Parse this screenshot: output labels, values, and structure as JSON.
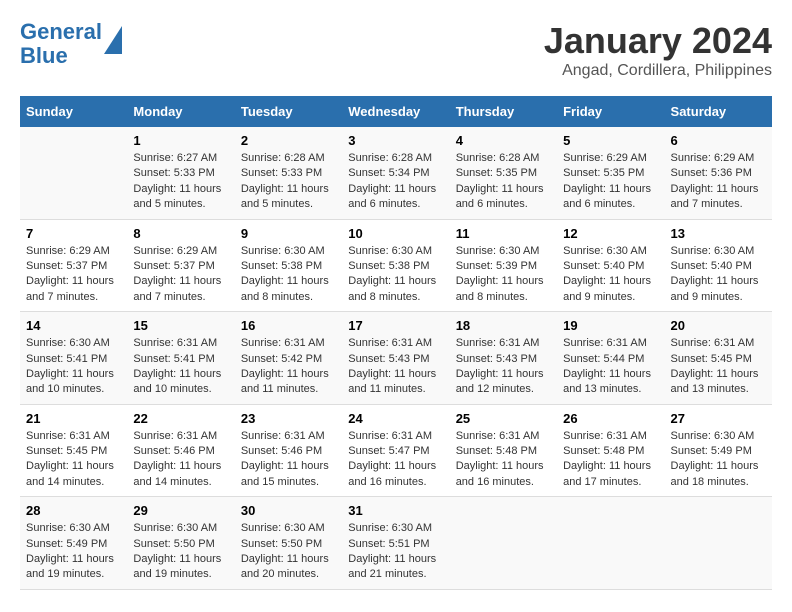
{
  "header": {
    "logo_line1": "General",
    "logo_line2": "Blue",
    "month": "January 2024",
    "location": "Angad, Cordillera, Philippines"
  },
  "weekdays": [
    "Sunday",
    "Monday",
    "Tuesday",
    "Wednesday",
    "Thursday",
    "Friday",
    "Saturday"
  ],
  "weeks": [
    [
      {
        "day": "",
        "sunrise": "",
        "sunset": "",
        "daylight": ""
      },
      {
        "day": "1",
        "sunrise": "Sunrise: 6:27 AM",
        "sunset": "Sunset: 5:33 PM",
        "daylight": "Daylight: 11 hours and 5 minutes."
      },
      {
        "day": "2",
        "sunrise": "Sunrise: 6:28 AM",
        "sunset": "Sunset: 5:33 PM",
        "daylight": "Daylight: 11 hours and 5 minutes."
      },
      {
        "day": "3",
        "sunrise": "Sunrise: 6:28 AM",
        "sunset": "Sunset: 5:34 PM",
        "daylight": "Daylight: 11 hours and 6 minutes."
      },
      {
        "day": "4",
        "sunrise": "Sunrise: 6:28 AM",
        "sunset": "Sunset: 5:35 PM",
        "daylight": "Daylight: 11 hours and 6 minutes."
      },
      {
        "day": "5",
        "sunrise": "Sunrise: 6:29 AM",
        "sunset": "Sunset: 5:35 PM",
        "daylight": "Daylight: 11 hours and 6 minutes."
      },
      {
        "day": "6",
        "sunrise": "Sunrise: 6:29 AM",
        "sunset": "Sunset: 5:36 PM",
        "daylight": "Daylight: 11 hours and 7 minutes."
      }
    ],
    [
      {
        "day": "7",
        "sunrise": "Sunrise: 6:29 AM",
        "sunset": "Sunset: 5:37 PM",
        "daylight": "Daylight: 11 hours and 7 minutes."
      },
      {
        "day": "8",
        "sunrise": "Sunrise: 6:29 AM",
        "sunset": "Sunset: 5:37 PM",
        "daylight": "Daylight: 11 hours and 7 minutes."
      },
      {
        "day": "9",
        "sunrise": "Sunrise: 6:30 AM",
        "sunset": "Sunset: 5:38 PM",
        "daylight": "Daylight: 11 hours and 8 minutes."
      },
      {
        "day": "10",
        "sunrise": "Sunrise: 6:30 AM",
        "sunset": "Sunset: 5:38 PM",
        "daylight": "Daylight: 11 hours and 8 minutes."
      },
      {
        "day": "11",
        "sunrise": "Sunrise: 6:30 AM",
        "sunset": "Sunset: 5:39 PM",
        "daylight": "Daylight: 11 hours and 8 minutes."
      },
      {
        "day": "12",
        "sunrise": "Sunrise: 6:30 AM",
        "sunset": "Sunset: 5:40 PM",
        "daylight": "Daylight: 11 hours and 9 minutes."
      },
      {
        "day": "13",
        "sunrise": "Sunrise: 6:30 AM",
        "sunset": "Sunset: 5:40 PM",
        "daylight": "Daylight: 11 hours and 9 minutes."
      }
    ],
    [
      {
        "day": "14",
        "sunrise": "Sunrise: 6:30 AM",
        "sunset": "Sunset: 5:41 PM",
        "daylight": "Daylight: 11 hours and 10 minutes."
      },
      {
        "day": "15",
        "sunrise": "Sunrise: 6:31 AM",
        "sunset": "Sunset: 5:41 PM",
        "daylight": "Daylight: 11 hours and 10 minutes."
      },
      {
        "day": "16",
        "sunrise": "Sunrise: 6:31 AM",
        "sunset": "Sunset: 5:42 PM",
        "daylight": "Daylight: 11 hours and 11 minutes."
      },
      {
        "day": "17",
        "sunrise": "Sunrise: 6:31 AM",
        "sunset": "Sunset: 5:43 PM",
        "daylight": "Daylight: 11 hours and 11 minutes."
      },
      {
        "day": "18",
        "sunrise": "Sunrise: 6:31 AM",
        "sunset": "Sunset: 5:43 PM",
        "daylight": "Daylight: 11 hours and 12 minutes."
      },
      {
        "day": "19",
        "sunrise": "Sunrise: 6:31 AM",
        "sunset": "Sunset: 5:44 PM",
        "daylight": "Daylight: 11 hours and 13 minutes."
      },
      {
        "day": "20",
        "sunrise": "Sunrise: 6:31 AM",
        "sunset": "Sunset: 5:45 PM",
        "daylight": "Daylight: 11 hours and 13 minutes."
      }
    ],
    [
      {
        "day": "21",
        "sunrise": "Sunrise: 6:31 AM",
        "sunset": "Sunset: 5:45 PM",
        "daylight": "Daylight: 11 hours and 14 minutes."
      },
      {
        "day": "22",
        "sunrise": "Sunrise: 6:31 AM",
        "sunset": "Sunset: 5:46 PM",
        "daylight": "Daylight: 11 hours and 14 minutes."
      },
      {
        "day": "23",
        "sunrise": "Sunrise: 6:31 AM",
        "sunset": "Sunset: 5:46 PM",
        "daylight": "Daylight: 11 hours and 15 minutes."
      },
      {
        "day": "24",
        "sunrise": "Sunrise: 6:31 AM",
        "sunset": "Sunset: 5:47 PM",
        "daylight": "Daylight: 11 hours and 16 minutes."
      },
      {
        "day": "25",
        "sunrise": "Sunrise: 6:31 AM",
        "sunset": "Sunset: 5:48 PM",
        "daylight": "Daylight: 11 hours and 16 minutes."
      },
      {
        "day": "26",
        "sunrise": "Sunrise: 6:31 AM",
        "sunset": "Sunset: 5:48 PM",
        "daylight": "Daylight: 11 hours and 17 minutes."
      },
      {
        "day": "27",
        "sunrise": "Sunrise: 6:30 AM",
        "sunset": "Sunset: 5:49 PM",
        "daylight": "Daylight: 11 hours and 18 minutes."
      }
    ],
    [
      {
        "day": "28",
        "sunrise": "Sunrise: 6:30 AM",
        "sunset": "Sunset: 5:49 PM",
        "daylight": "Daylight: 11 hours and 19 minutes."
      },
      {
        "day": "29",
        "sunrise": "Sunrise: 6:30 AM",
        "sunset": "Sunset: 5:50 PM",
        "daylight": "Daylight: 11 hours and 19 minutes."
      },
      {
        "day": "30",
        "sunrise": "Sunrise: 6:30 AM",
        "sunset": "Sunset: 5:50 PM",
        "daylight": "Daylight: 11 hours and 20 minutes."
      },
      {
        "day": "31",
        "sunrise": "Sunrise: 6:30 AM",
        "sunset": "Sunset: 5:51 PM",
        "daylight": "Daylight: 11 hours and 21 minutes."
      },
      {
        "day": "",
        "sunrise": "",
        "sunset": "",
        "daylight": ""
      },
      {
        "day": "",
        "sunrise": "",
        "sunset": "",
        "daylight": ""
      },
      {
        "day": "",
        "sunrise": "",
        "sunset": "",
        "daylight": ""
      }
    ]
  ]
}
